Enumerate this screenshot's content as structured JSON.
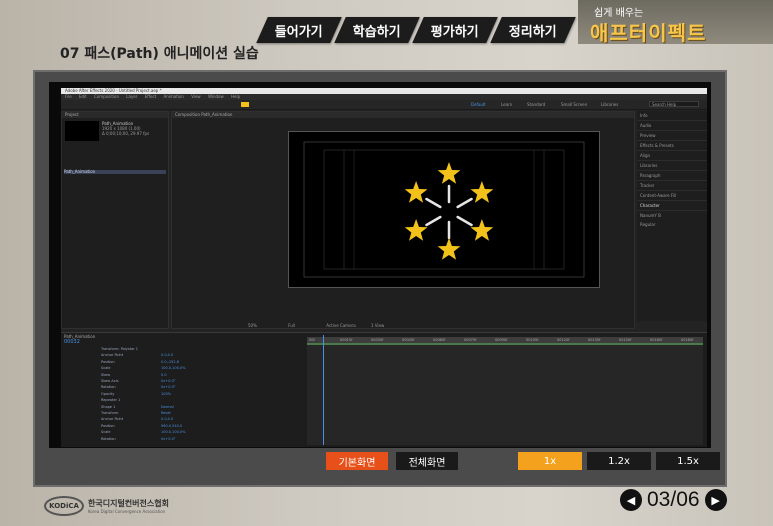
{
  "nav": {
    "items": [
      "들어가기",
      "학습하기",
      "평가하기",
      "정리하기"
    ]
  },
  "brand": {
    "small": "쉽게 배우는",
    "big": "애프터이펙트"
  },
  "lesson": {
    "title": "07 패스(Path) 애니메이션 실습"
  },
  "ae": {
    "window_title": "Adobe After Effects 2020 - Untitled Project.aep *",
    "menu": [
      "File",
      "Edit",
      "Composition",
      "Layer",
      "Effect",
      "Animation",
      "View",
      "Window",
      "Help"
    ],
    "project_label": "Project",
    "comp_name": "Path_Animation",
    "comp_info": "1920 x 1080 (1.00)",
    "comp_duration": "Δ 0;00;10;00, 29.97 fps",
    "composition_tab": "Composition Path_Animation",
    "workspace": [
      "Default",
      "Learn",
      "Standard",
      "Small Screen",
      "Libraries"
    ],
    "search_help": "Search Help",
    "right_panel": [
      "Info",
      "Audio",
      "Preview",
      "Effects & Presets",
      "Align",
      "Libraries",
      "Paragraph",
      "Tracker",
      "Content-Aware Fill",
      "Character"
    ],
    "character_font": "NanumY B",
    "character_style": "Regular",
    "timecode": "00032",
    "zoom": "50%",
    "resolution": "Full",
    "camera": "Active Camera",
    "view": "1 View",
    "timeline_tab": "Path_Animation",
    "layers": [
      {
        "name": "Transform: Polystar 1",
        "value": ""
      },
      {
        "name": "Anchor Point",
        "value": "0.0,0.0"
      },
      {
        "name": "Position",
        "value": "0.0,-252.8"
      },
      {
        "name": "Scale",
        "value": "100.0,100.0%"
      },
      {
        "name": "Skew",
        "value": "0.0"
      },
      {
        "name": "Skew Axis",
        "value": "0x+0.0°"
      },
      {
        "name": "Rotation",
        "value": "0x+0.0°"
      },
      {
        "name": "Opacity",
        "value": "100%"
      },
      {
        "name": "Repeater 1",
        "value": ""
      },
      {
        "name": "Shape 1",
        "value": "Normal"
      },
      {
        "name": "Transform",
        "value": "Reset"
      },
      {
        "name": "Anchor Point",
        "value": "0.0,0.0"
      },
      {
        "name": "Position",
        "value": "960.0,540.0"
      },
      {
        "name": "Scale",
        "value": "100.0,100.0%"
      },
      {
        "name": "Rotation",
        "value": "0x+0.0°"
      }
    ],
    "time_ruler": [
      "00f",
      "00015f",
      "00030f",
      "00045f",
      "00060f",
      "00075f",
      "00090f",
      "00105f",
      "00120f",
      "00135f",
      "00150f",
      "00165f",
      "00180f"
    ]
  },
  "controls": {
    "basic_view": "기본화면",
    "full_view": "전체화면",
    "speed_1": "1x",
    "speed_2": "1.2x",
    "speed_3": "1.5x"
  },
  "pager": {
    "page": "03/06"
  },
  "logo": {
    "mark": "KODiCA",
    "name": "한국디지털컨버전스협회",
    "sub": "Korea Digital Convergence Association"
  },
  "colors": {
    "accent_orange": "#e8501a",
    "speed_active": "#f4a21d",
    "star_yellow": "#f3c21a",
    "brand_gold": "#f6c64c"
  }
}
